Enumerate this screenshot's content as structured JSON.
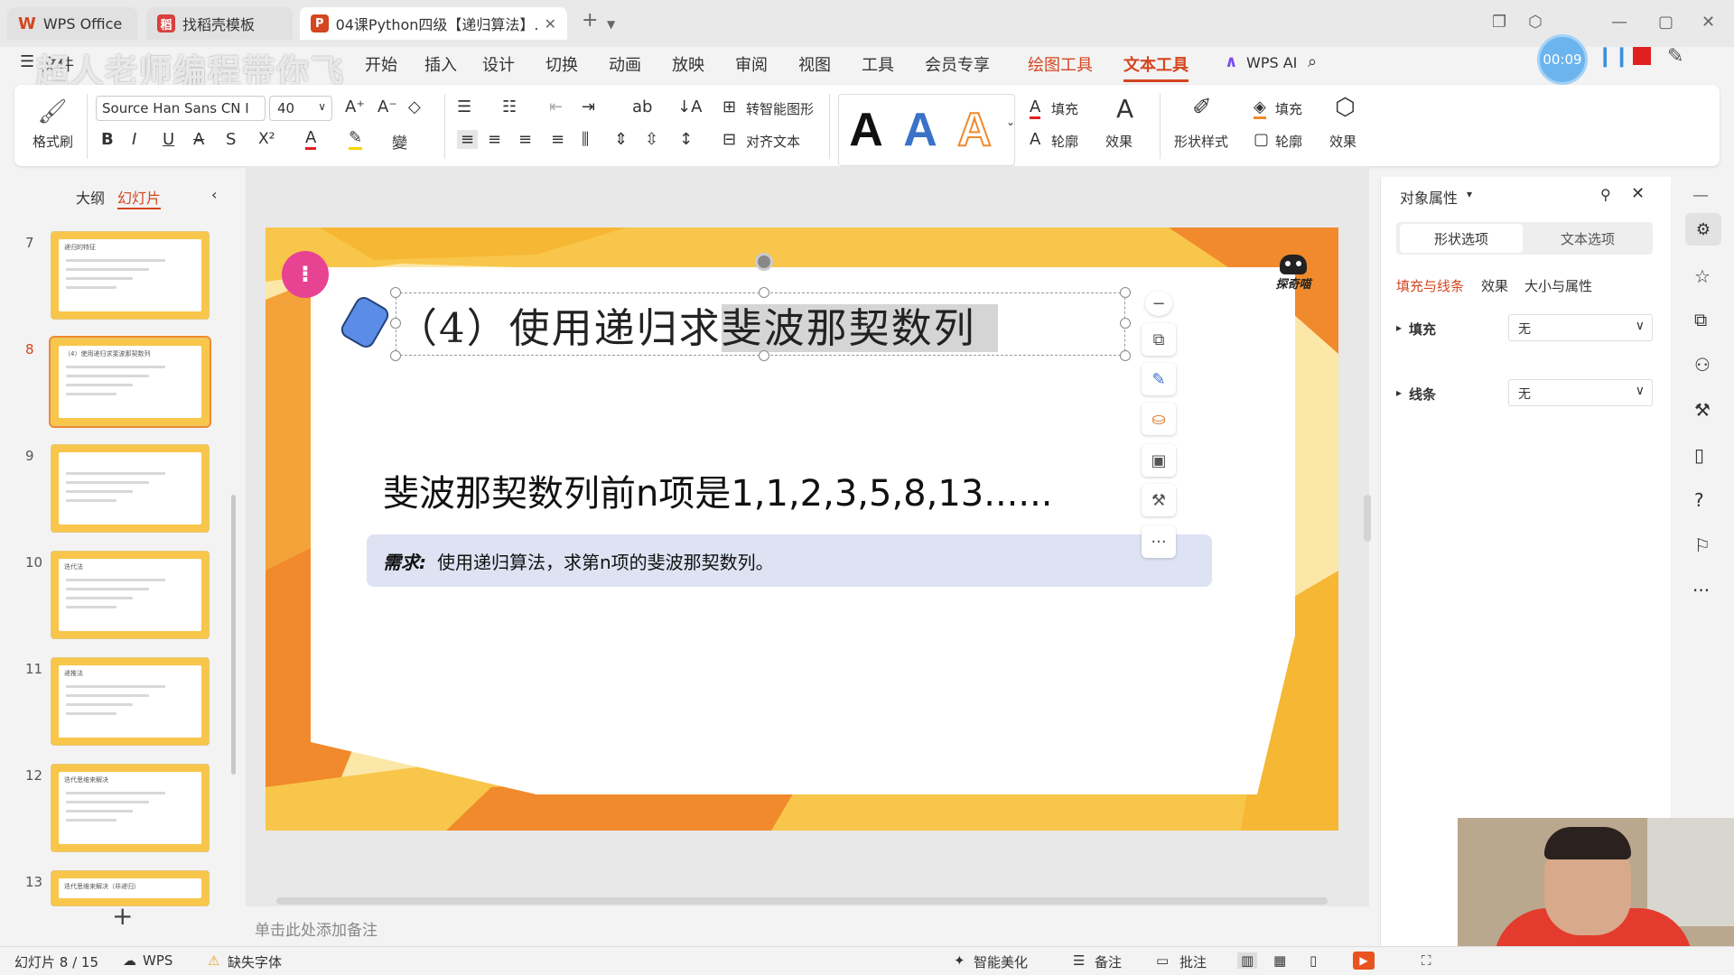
{
  "tabs": [
    {
      "label": "WPS Office",
      "icon": "wps-logo-icon"
    },
    {
      "label": "找稻壳模板",
      "icon": "docer-icon"
    },
    {
      "label": "04课Python四级【递归算法】.pp",
      "icon": "ppt-icon"
    }
  ],
  "menu": {
    "items": [
      "文件",
      "开始",
      "插入",
      "设计",
      "切换",
      "动画",
      "放映",
      "审阅",
      "视图",
      "工具",
      "会员专享",
      "绘图工具",
      "文本工具",
      "WPS AI"
    ],
    "active": "文本工具",
    "overlay_text": "超人老师编程带你飞"
  },
  "recorder": {
    "time": "00:09"
  },
  "ribbon": {
    "format_painter": "格式刷",
    "font_name": "Source Han Sans CN I",
    "font_size": "40",
    "to_smartart": "转智能图形",
    "align_text": "对齐文本",
    "fill": "填充",
    "outline": "轮廓",
    "effect": "效果",
    "shape_style": "形状样式",
    "fill2": "填充",
    "outline2": "轮廓",
    "effect2": "效果"
  },
  "left_panel": {
    "tab_outline": "大纲",
    "tab_slides": "幻灯片",
    "slides": [
      {
        "num": "7",
        "title": "递归的特征"
      },
      {
        "num": "8",
        "title": "（4）使用递归求斐波那契数列"
      },
      {
        "num": "9",
        "title": ""
      },
      {
        "num": "10",
        "title": "迭代法"
      },
      {
        "num": "11",
        "title": "递推法"
      },
      {
        "num": "12",
        "title": "迭代思维来解决"
      },
      {
        "num": "13",
        "title": "迭代思维来解决（非递归）"
      }
    ],
    "current": "8"
  },
  "slide": {
    "title_part1": "（4）使用递归求",
    "title_part2": "斐波那契数列",
    "logo_text": "探奇喵",
    "main_text": "斐波那契数列前n项是1,1,2,3,5,8,13......",
    "req_label": "需求:",
    "req_text": "使用递归算法，求第n项的斐波那契数列。"
  },
  "notes_placeholder": "单击此处添加备注",
  "right_panel": {
    "title": "对象属性",
    "tab_shape": "形状选项",
    "tab_text": "文本选项",
    "sub_fill_line": "填充与线条",
    "sub_effect": "效果",
    "sub_size": "大小与属性",
    "fill_label": "填充",
    "fill_value": "无",
    "line_label": "线条",
    "line_value": "无"
  },
  "status": {
    "slide_info": "幻灯片 8 / 15",
    "wps": "WPS",
    "missing_font": "缺失字体",
    "beautify": "智能美化",
    "notes": "备注",
    "comments": "批注"
  },
  "colors": {
    "accent": "#d4461f",
    "orange": "#f08a2c",
    "yellow": "#f8c64a",
    "req_bg": "#dde3f3"
  }
}
